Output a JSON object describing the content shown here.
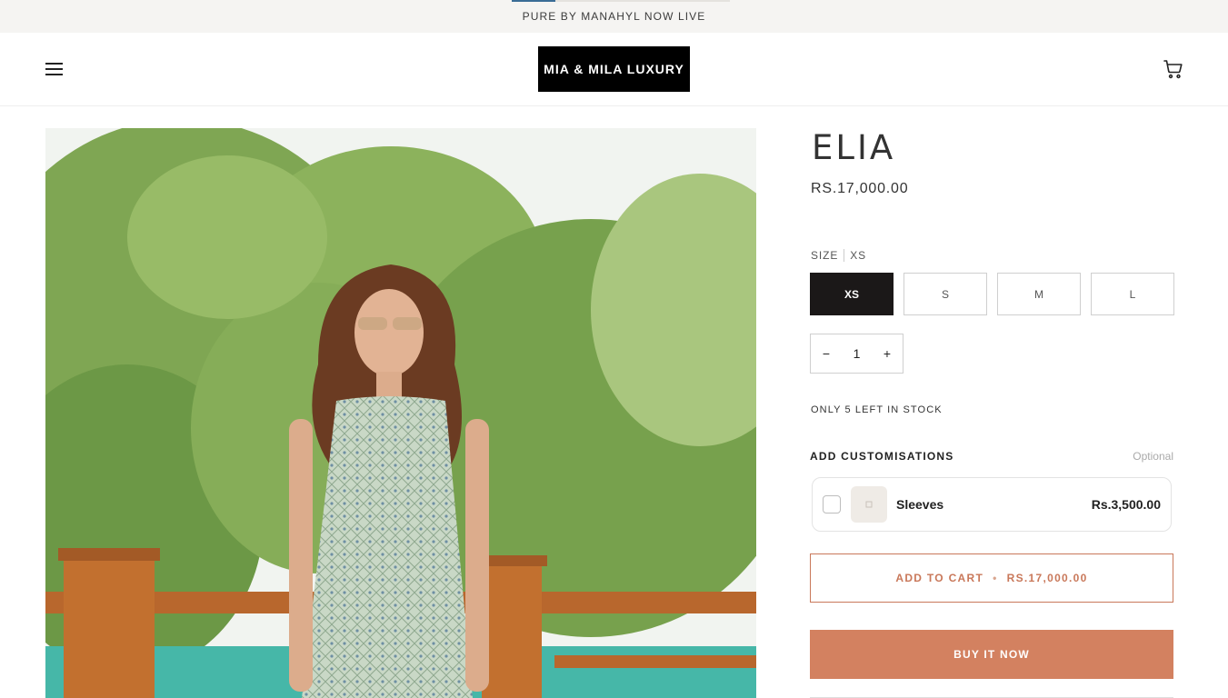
{
  "announcement": {
    "text": "PURE BY MANAHYL NOW LIVE"
  },
  "header": {
    "logo": "MIA & MILA LUXURY"
  },
  "product": {
    "title": "ELIA",
    "price": "RS.17,000.00",
    "size_label": "SIZE",
    "selected_size": "XS",
    "sizes": [
      "XS",
      "S",
      "M",
      "L"
    ],
    "quantity": "1",
    "qty_minus": "−",
    "qty_plus": "+",
    "stock_text": "ONLY 5 LEFT IN STOCK"
  },
  "customisations": {
    "title": "ADD CUSTOMISATIONS",
    "optional_label": "Optional",
    "items": [
      {
        "name": "Sleeves",
        "price": "Rs.3,500.00"
      }
    ]
  },
  "actions": {
    "add_to_cart": "ADD TO CART",
    "separator": "•",
    "add_to_cart_price": "RS.17,000.00",
    "buy_now": "BUY IT NOW"
  },
  "colors": {
    "accent": "#d38160",
    "accent_outline": "#c9785a",
    "selected_size_bg": "#1b1818",
    "logo_bg": "#000000"
  },
  "icons": {
    "menu": "hamburger-menu-icon",
    "cart": "shopping-cart-icon"
  }
}
